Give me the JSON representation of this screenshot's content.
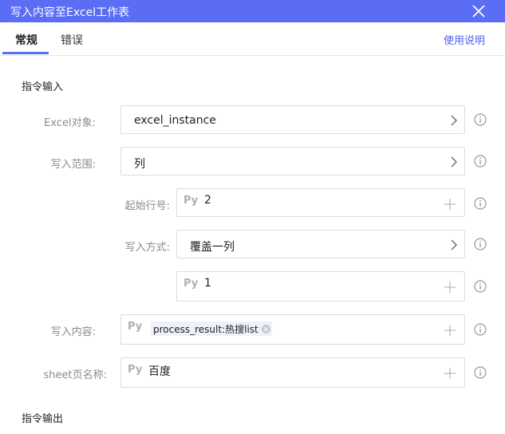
{
  "window": {
    "title": "写入内容至Excel工作表",
    "close_icon": "close-icon"
  },
  "tabs": [
    {
      "label": "常规",
      "active": true
    },
    {
      "label": "错误",
      "active": false
    }
  ],
  "help_link": "使用说明",
  "sections": {
    "input": "指令输入",
    "output": "指令输出"
  },
  "fields": {
    "excel_object": {
      "label": "Excel对象:",
      "value": "excel_instance"
    },
    "write_range": {
      "label": "写入范围:",
      "value": "列"
    },
    "start_row": {
      "label": "起始行号:",
      "prefix": "Py",
      "value": "2"
    },
    "write_mode": {
      "label": "写入方式:",
      "value": "覆盖一列"
    },
    "column_index": {
      "prefix": "Py",
      "value": "1"
    },
    "write_content": {
      "label": "写入内容:",
      "prefix": "Py",
      "chip": "process_result:热搜list"
    },
    "sheet_name": {
      "label": "sheet页名称:",
      "prefix": "Py",
      "value": "百度"
    }
  },
  "colors": {
    "accent": "#5b6cf5",
    "link": "#4a5ef5"
  }
}
